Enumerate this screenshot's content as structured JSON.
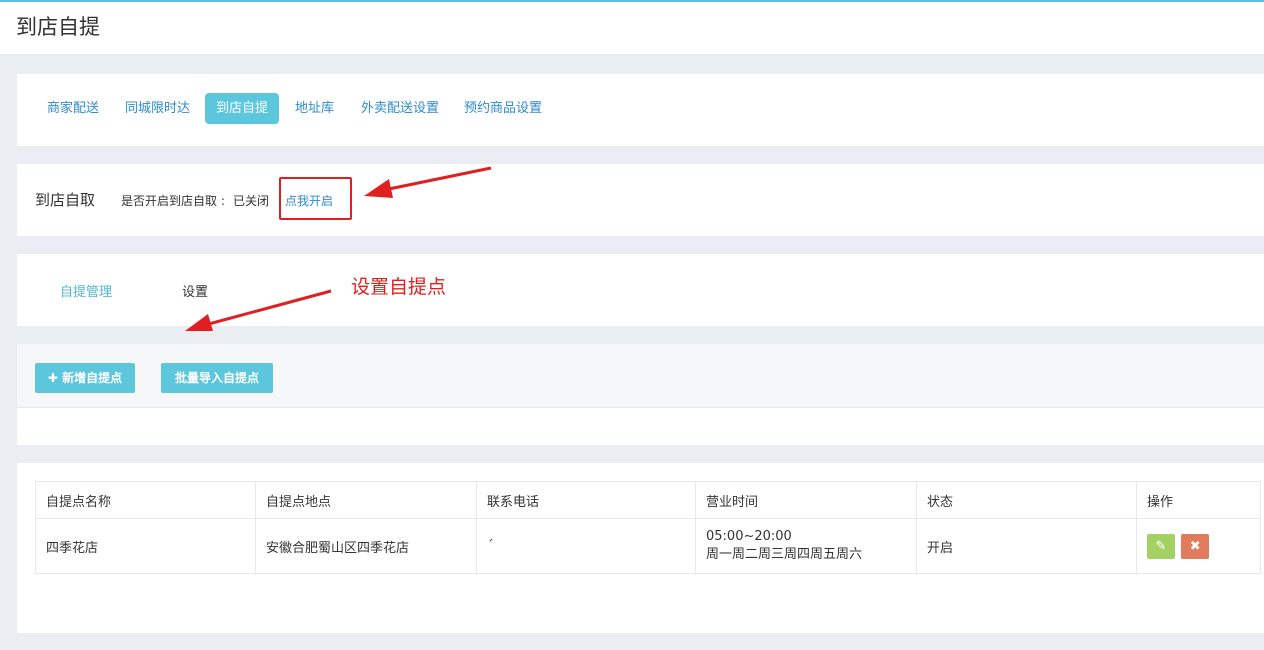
{
  "page": {
    "title": "到店自提"
  },
  "nav": {
    "tabs": [
      {
        "label": "商家配送",
        "active": false
      },
      {
        "label": "同城限时达",
        "active": false
      },
      {
        "label": "到店自提",
        "active": true
      },
      {
        "label": "地址库",
        "active": false
      },
      {
        "label": "外卖配送设置",
        "active": false
      },
      {
        "label": "预约商品设置",
        "active": false
      }
    ]
  },
  "pickup": {
    "title": "到店自取",
    "status_label": "是否开启到店自取 :",
    "status_value": "已关闭",
    "enable_link": "点我开启"
  },
  "subtabs": [
    {
      "label": "自提管理",
      "active": true
    },
    {
      "label": "设置",
      "active": false
    }
  ],
  "annotation": {
    "text": "设置自提点"
  },
  "actions": {
    "add_label": "✚ 新增自提点",
    "import_label": "批量导入自提点"
  },
  "table": {
    "columns": [
      "自提点名称",
      "自提点地点",
      "联系电话",
      "营业时间",
      "状态",
      "操作"
    ],
    "rows": [
      {
        "name": "四季花店",
        "address": "安徽合肥蜀山区四季花店",
        "phone": "ˊ",
        "hours_time": "05:00~20:00",
        "hours_days": "周一周二周三周四周五周六",
        "status": "开启",
        "edit_icon": "pencil-icon",
        "delete_icon": "close-icon"
      }
    ]
  },
  "colors": {
    "accent": "#5bc6dc",
    "link": "#2e8bd0",
    "annotation_red": "#e02020",
    "edit_green": "#a4d262",
    "delete_orange": "#e07c5b"
  }
}
